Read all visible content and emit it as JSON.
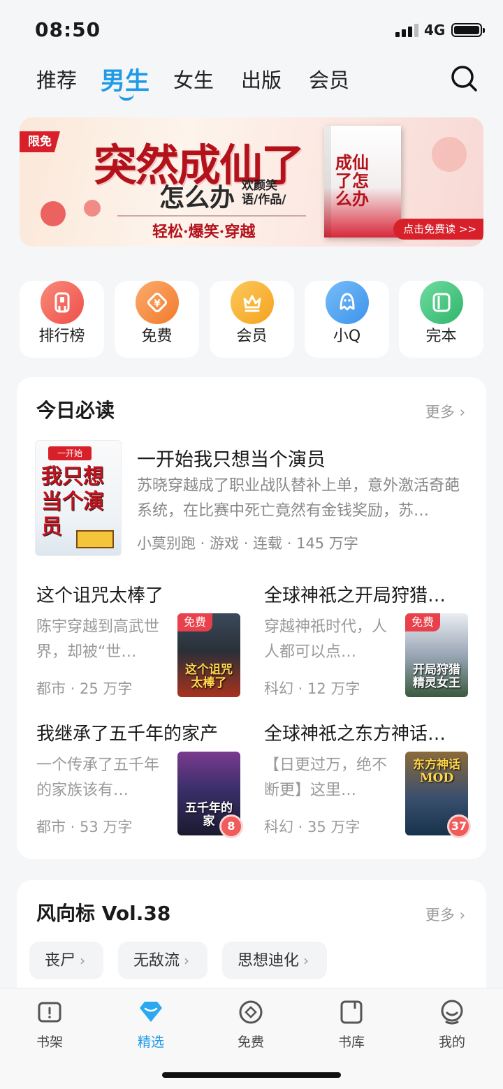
{
  "status": {
    "time": "08:50",
    "network": "4G"
  },
  "tabs": [
    {
      "label": "推荐",
      "active": false
    },
    {
      "label": "男生",
      "active": true
    },
    {
      "label": "女生",
      "active": false
    },
    {
      "label": "出版",
      "active": false
    },
    {
      "label": "会员",
      "active": false
    }
  ],
  "banner": {
    "tag": "限免",
    "title": "突然成仙了",
    "subtitle": "怎么办",
    "author": "欢颜笑语/作品/",
    "tagline": "轻松·爆笑·穿越",
    "cover_text": "成仙了怎么办",
    "cta": "点击免费读 >>"
  },
  "categories": [
    {
      "label": "排行榜",
      "icon": "ranking-icon",
      "color": "#f2615b"
    },
    {
      "label": "免费",
      "icon": "free-coin-icon",
      "color": "#f58a3c"
    },
    {
      "label": "会员",
      "icon": "crown-icon",
      "color": "#f7ad2b"
    },
    {
      "label": "小Q",
      "icon": "penguin-icon",
      "color": "#4ea6f2"
    },
    {
      "label": "完本",
      "icon": "book-complete-icon",
      "color": "#3ec47a"
    }
  ],
  "today": {
    "heading": "今日必读",
    "more": "更多",
    "featured": {
      "title": "一开始我只想当个演员",
      "desc": "苏晓穿越成了职业战队替补上单，意外激活奇葩系统，在比赛中死亡竟然有金钱奖励，苏…",
      "meta": "小莫别跑 · 游戏 · 连载 · 145 万字",
      "cover_text": "我只想当个演员"
    },
    "books": [
      {
        "title": "这个诅咒太棒了",
        "desc": "陈宇穿越到高武世界，却被“世…",
        "meta": "都市 · 25 万字",
        "badge": "免费",
        "cover_text": "这个诅咒太棒了"
      },
      {
        "title": "全球神祇之开局狩猎…",
        "desc": "穿越神祇时代，人人都可以点…",
        "meta": "科幻 · 12 万字",
        "badge": "免费",
        "cover_text": "开局狩猎精灵女王"
      },
      {
        "title": "我继承了五千年的家产",
        "desc": "一个传承了五千年的家族该有…",
        "meta": "都市 · 53 万字",
        "count": "8",
        "cover_text": "五千年的家"
      },
      {
        "title": "全球神祇之东方神话…",
        "desc": "【日更过万，绝不断更】这里…",
        "meta": "科幻 · 35 万字",
        "count": "37",
        "cover_text": "东方神话MOD"
      }
    ]
  },
  "wind": {
    "heading": "风向标 Vol.38",
    "more": "更多",
    "chips": [
      "丧尸",
      "无敌流",
      "思想迪化"
    ]
  },
  "bottom_nav": [
    {
      "label": "书架",
      "icon": "bookshelf-icon",
      "active": false
    },
    {
      "label": "精选",
      "icon": "diamond-icon",
      "active": true
    },
    {
      "label": "免费",
      "icon": "free-icon",
      "active": false
    },
    {
      "label": "书库",
      "icon": "library-icon",
      "active": false
    },
    {
      "label": "我的",
      "icon": "profile-icon",
      "active": false
    }
  ],
  "colors": {
    "accent": "#1f9ae8",
    "badge_red": "#e8414b"
  }
}
